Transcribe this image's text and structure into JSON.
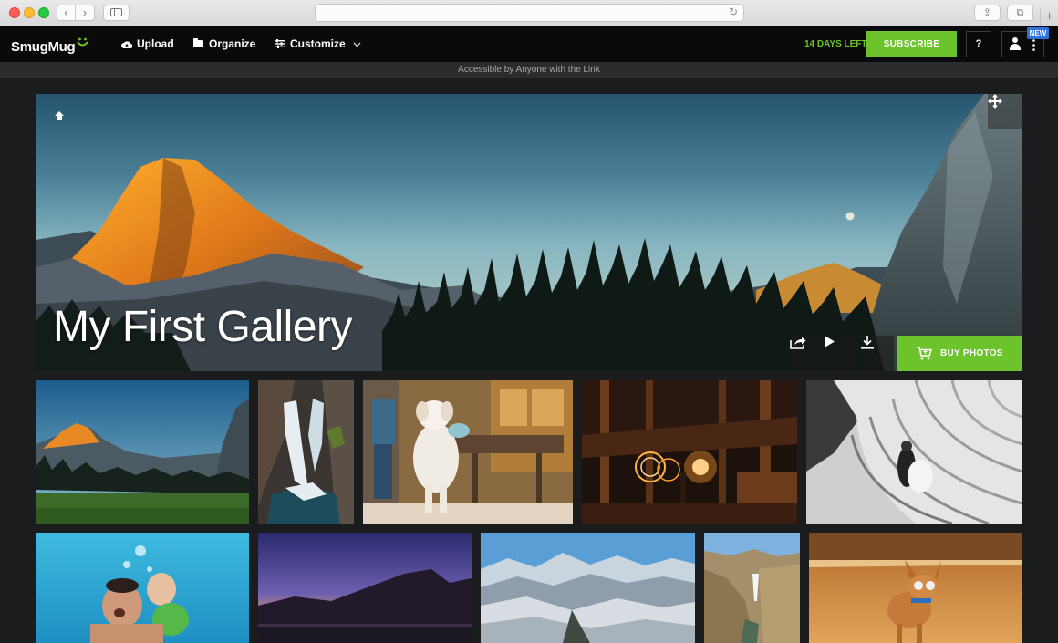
{
  "browser": {
    "nav_back": "‹",
    "nav_forward": "›",
    "reload_glyph": "↻",
    "share_glyph": "⇪",
    "tabs_glyph": "⧉",
    "new_tab_glyph": "+"
  },
  "header": {
    "logo": "SmugMug",
    "logo_mark": "ᵕ̈",
    "nav": [
      {
        "label": "Upload",
        "icon": "cloud-upload-icon"
      },
      {
        "label": "Organize",
        "icon": "folder-icon"
      },
      {
        "label": "Customize",
        "icon": "sliders-icon"
      }
    ],
    "trial": "14 DAYS LEFT",
    "subscribe": "SUBSCRIBE",
    "help": "?",
    "new_badge": "NEW"
  },
  "access_notice": "Accessible by Anyone with the Link",
  "gallery": {
    "title": "My First Gallery",
    "buy": "BUY PHOTOS"
  },
  "colors": {
    "accent_green": "#6cc32b",
    "badge_blue": "#2f73e0",
    "topbar": "#0a0a0b",
    "page_bg": "#1b1c1e"
  },
  "thumbnails": [
    {
      "subject": "mountain valley"
    },
    {
      "subject": "waterfall"
    },
    {
      "subject": "dog in kitchen"
    },
    {
      "subject": "light painting at night"
    },
    {
      "subject": "couple on staircase"
    },
    {
      "subject": "underwater swimmers"
    },
    {
      "subject": "twilight lake"
    },
    {
      "subject": "snowy mountains"
    },
    {
      "subject": "canyon waterfall"
    },
    {
      "subject": "dog with sunglasses"
    }
  ]
}
